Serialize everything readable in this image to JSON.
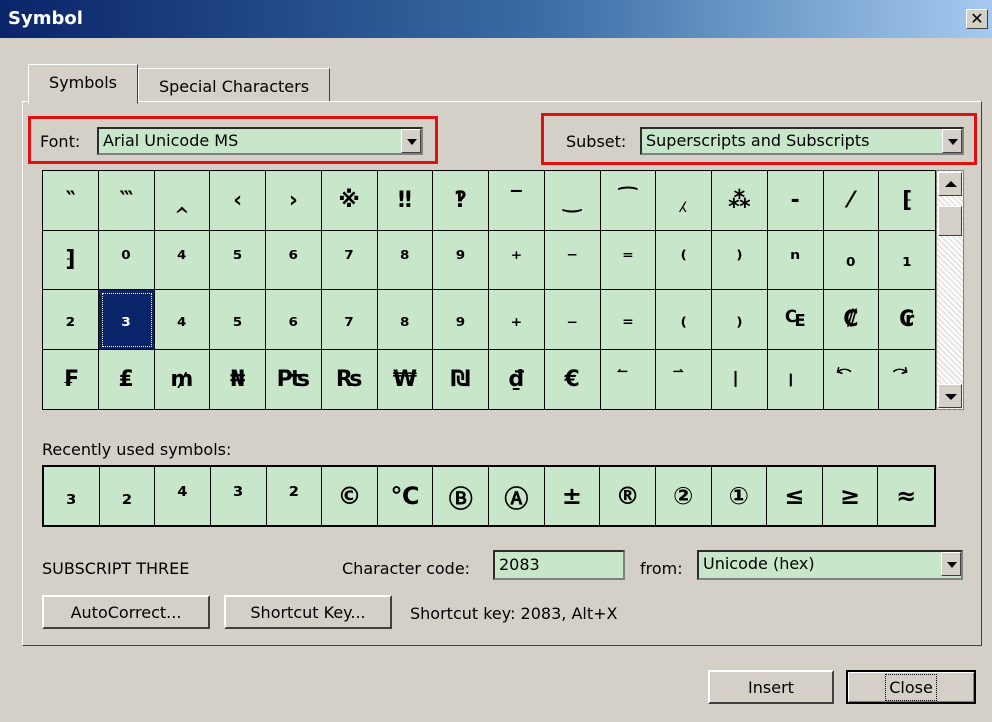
{
  "title": "Symbol",
  "close_glyph": "✕",
  "tabs": [
    {
      "label": "Symbols"
    },
    {
      "label": "Special Characters"
    }
  ],
  "font": {
    "label": "Font:",
    "value": "Arial Unicode MS"
  },
  "subset": {
    "label": "Subset:",
    "value": "Superscripts and Subscripts"
  },
  "symbols": [
    "‶",
    "‷",
    "‸",
    "‹",
    "›",
    "※",
    "‼",
    "‽",
    "‾",
    "‿",
    "⁀",
    "⁁",
    "⁂",
    "⁃",
    "⁄",
    "⁅",
    "⁆",
    "⁰",
    "⁴",
    "⁵",
    "⁶",
    "⁷",
    "⁸",
    "⁹",
    "⁺",
    "⁻",
    "⁼",
    "⁽",
    "⁾",
    "ⁿ",
    "₀",
    "₁",
    "₂",
    "₃",
    "₄",
    "₅",
    "₆",
    "₇",
    "₈",
    "₉",
    "₊",
    "₋",
    "₌",
    "₍",
    "₎",
    "₠",
    "₡",
    "₢",
    "₣",
    "₤",
    "₥",
    "₦",
    "₧",
    "₨",
    "₩",
    "₪",
    "₫",
    "€",
    "⃐",
    "⃑",
    "⃒",
    "⃓",
    "⃔",
    "⃕"
  ],
  "selected_symbol": "₃",
  "recent": {
    "label": "Recently used symbols:",
    "symbols": [
      "₃",
      "₂",
      "⁴",
      "³",
      "²",
      "©",
      "℃",
      "Ⓑ",
      "Ⓐ",
      "±",
      "®",
      "②",
      "①",
      "≤",
      "≥",
      "≈"
    ]
  },
  "char_name": "SUBSCRIPT THREE",
  "char_code": {
    "label": "Character code:",
    "value": "2083"
  },
  "from": {
    "label": "from:",
    "value": "Unicode (hex)"
  },
  "buttons": {
    "autocorrect": "AutoCorrect...",
    "shortcut": "Shortcut Key...",
    "insert": "Insert",
    "close": "Close"
  },
  "shortcut_info": "Shortcut key: 2083, Alt+X",
  "colors": {
    "title_bar": "#0a246a",
    "grid_bg": "#c8e6c9",
    "highlight": "#e01010",
    "dialog_bg": "#d4d0c8"
  }
}
